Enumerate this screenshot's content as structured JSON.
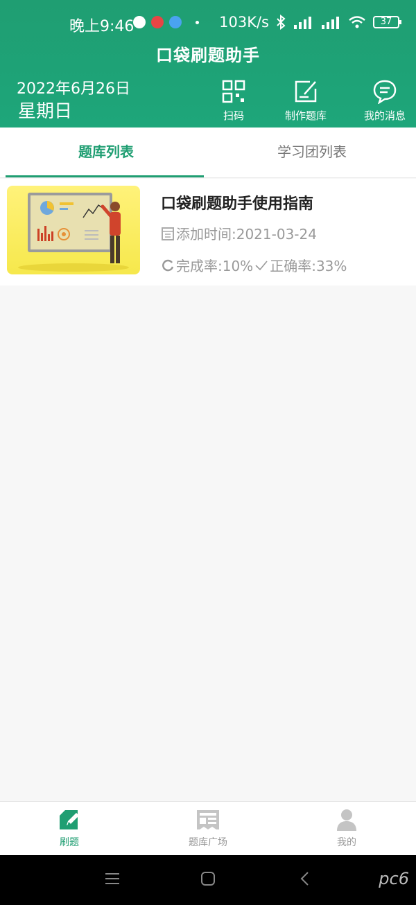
{
  "status_bar": {
    "time": "晚上9:46",
    "net_speed": "103K/s",
    "battery": "37"
  },
  "header": {
    "title": "口袋刷题助手",
    "date": "2022年6月26日",
    "weekday": "星期日",
    "actions": [
      {
        "label": "扫码",
        "icon": "qr-code-icon"
      },
      {
        "label": "制作题库",
        "icon": "edit-icon"
      },
      {
        "label": "我的消息",
        "icon": "chat-icon"
      }
    ]
  },
  "tabs": [
    {
      "label": "题库列表",
      "active": true
    },
    {
      "label": "学习团列表",
      "active": false
    }
  ],
  "bank_list": [
    {
      "title": "口袋刷题助手使用指南",
      "added_time": "添加时间:2021-03-24",
      "completion": "完成率:10%",
      "accuracy": "正确率:33%"
    }
  ],
  "bottom_nav": [
    {
      "label": "刷题",
      "icon": "practice-icon",
      "active": true
    },
    {
      "label": "题库广场",
      "icon": "newspaper-icon",
      "active": false
    },
    {
      "label": "我的",
      "icon": "person-icon",
      "active": false
    }
  ],
  "colors": {
    "primary": "#1f9e72",
    "muted": "#999999"
  },
  "watermark": "pc6"
}
